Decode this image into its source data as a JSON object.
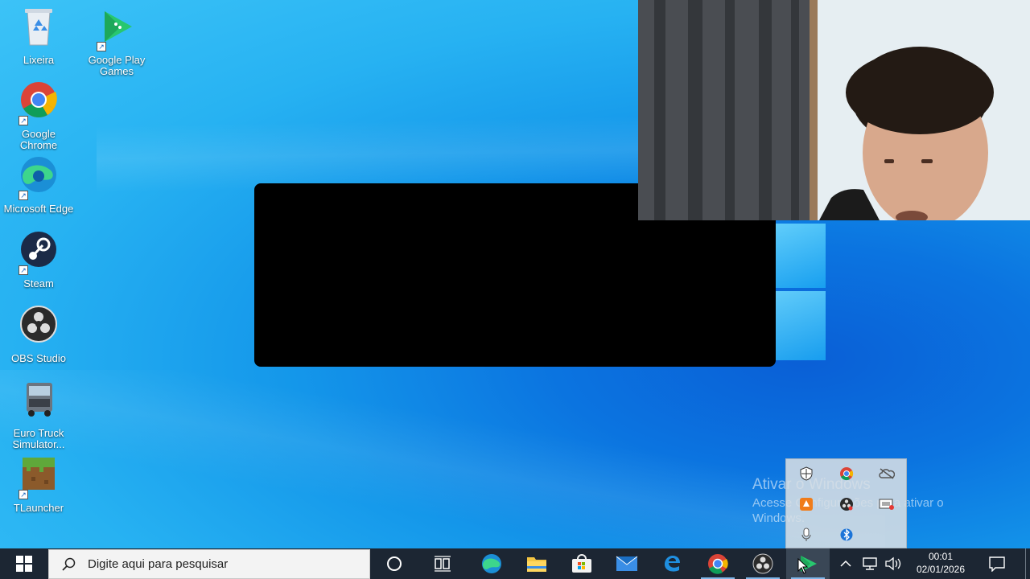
{
  "desktop": {
    "icons": [
      {
        "label": "Lixeira"
      },
      {
        "label": "Google Play Games"
      },
      {
        "label": "Google Chrome"
      },
      {
        "label": "Microsoft Edge"
      },
      {
        "label": "Steam"
      },
      {
        "label": "OBS Studio"
      },
      {
        "label": "Euro Truck Simulator..."
      },
      {
        "label": "TLauncher"
      }
    ]
  },
  "watermark": {
    "title": "Ativar o Windows",
    "subtitle": "Acesse Configurações para ativar o Windows."
  },
  "taskbar": {
    "search_placeholder": "Digite aqui para pesquisar",
    "time": "00:01",
    "date": "02/01/2026",
    "pinned": [
      "start-icon",
      "cortana-icon",
      "task-view-icon",
      "edge-icon",
      "file-explorer-icon",
      "store-icon",
      "mail-icon",
      "edge-legacy-icon",
      "chrome-icon",
      "obs-icon",
      "google-play-games-icon"
    ],
    "tray": [
      "show-hidden-icons-chevron",
      "network-icon",
      "volume-icon",
      "notifications-icon"
    ]
  },
  "tray_flyout": {
    "icons": [
      "windows-security-icon",
      "chrome-tray-icon",
      "onedrive-icon",
      "avast-icon",
      "obs-tray-icon",
      "screen-record-icon",
      "microphone-icon",
      "bluetooth-icon"
    ]
  },
  "colors": {
    "taskbar": "#1c2633",
    "accent": "#1497ea"
  }
}
